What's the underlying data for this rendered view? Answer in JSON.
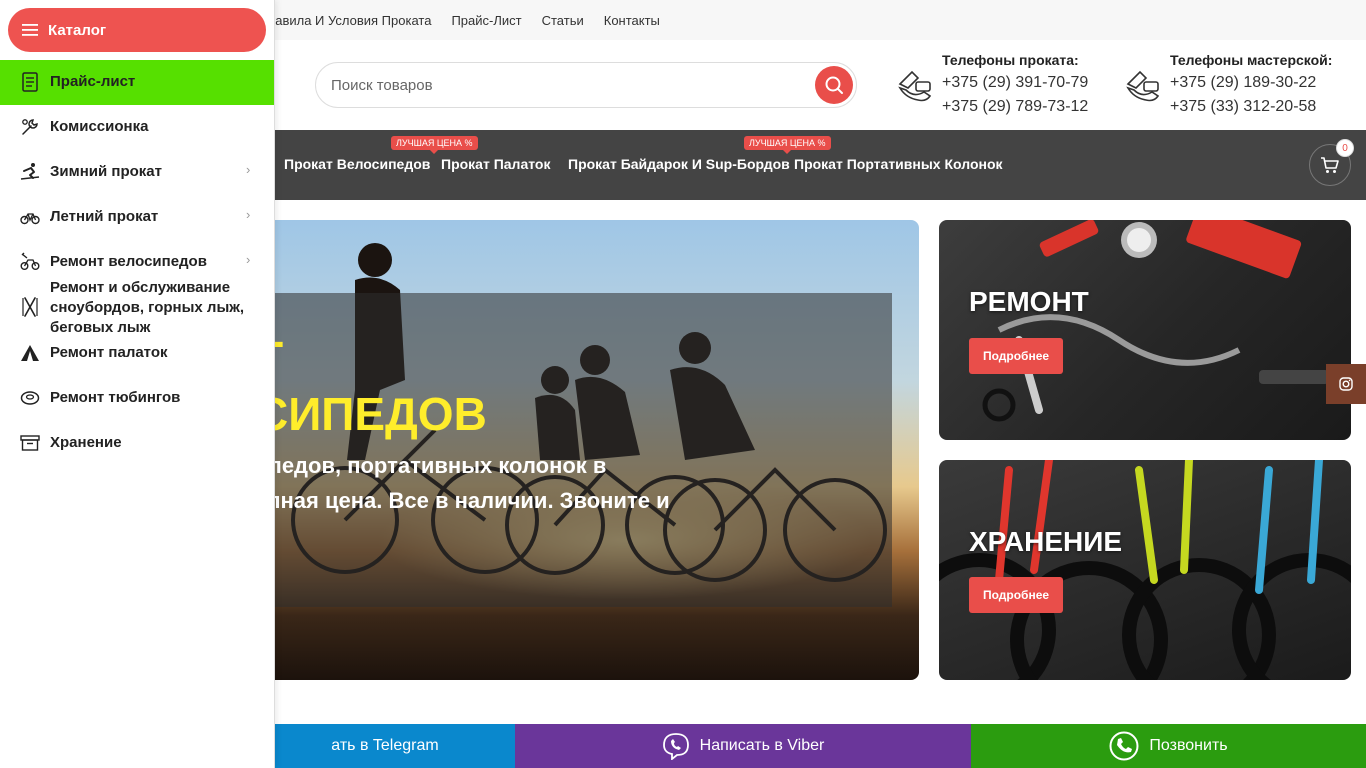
{
  "toplinks": [
    "равила И Условия Проката",
    "Прайс-Лист",
    "Статьи",
    "Контакты"
  ],
  "search": {
    "placeholder": "Поиск товаров"
  },
  "phones": {
    "rental": {
      "title": "Телефоны проката:",
      "numbers": [
        "+375 (29) 391-70-79",
        "+375 (29) 789-73-12"
      ]
    },
    "workshop": {
      "title": "Телефоны мастерской:",
      "numbers": [
        "+375 (29) 189-30-22",
        "+375 (33) 312-20-58"
      ]
    }
  },
  "nav": {
    "items": [
      "Прокат Велосипедов",
      "Прокат Палаток",
      "Прокат Байдарок И Sup-Бордов",
      "Прокат Портативных Колонок"
    ],
    "badge": "ЛУЧШАЯ ЦЕНА %",
    "cart_count": "0"
  },
  "hero": {
    "title_line1": "Т",
    "title_line2": "СИПЕДОВ",
    "text_line1": "ипедов, портативных колонок в",
    "text_line2": "упная цена. Все в наличии. Звоните и"
  },
  "cards": {
    "repair": {
      "title": "РЕМОНТ",
      "button": "Подробнее"
    },
    "storage": {
      "title": "ХРАНЕНИЕ",
      "button": "Подробнее"
    }
  },
  "bottom": {
    "telegram": "ать в Telegram",
    "viber": "Написать в Viber",
    "call": "Позвонить"
  },
  "catalog": {
    "button": "Каталог",
    "items": [
      {
        "label": "Прайс-лист",
        "icon": "price-list-icon",
        "chevron": false
      },
      {
        "label": "Комиссионка",
        "icon": "wrench-icon",
        "chevron": false
      },
      {
        "label": "Зимний прокат",
        "icon": "skier-icon",
        "chevron": true
      },
      {
        "label": "Летний прокат",
        "icon": "bicycle-icon",
        "chevron": true
      },
      {
        "label": "Ремонт велосипедов",
        "icon": "bike-repair-icon",
        "chevron": true
      },
      {
        "label": "Ремонт и обслуживание сноубордов, горных лыж, беговых лыж",
        "icon": "skis-icon",
        "chevron": false
      },
      {
        "label": "Ремонт палаток",
        "icon": "tent-icon",
        "chevron": false
      },
      {
        "label": "Ремонт тюбингов",
        "icon": "tubing-icon",
        "chevron": false
      },
      {
        "label": "Хранение",
        "icon": "storage-box-icon",
        "chevron": false
      }
    ],
    "chevron_glyph": "›"
  },
  "colors": {
    "accent": "#e94e4a",
    "active_menu": "#56e000",
    "nav_bg": "#444444",
    "hero_title": "#ffed2b",
    "telegram": "#0a88cd",
    "viber": "#6a369a",
    "call": "#2b9c0f"
  }
}
